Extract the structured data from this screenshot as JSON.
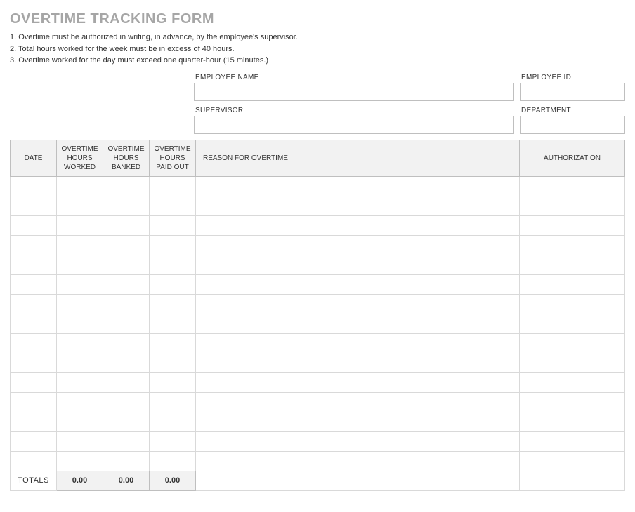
{
  "title": "OVERTIME TRACKING FORM",
  "rules": {
    "r1": "1. Overtime must be authorized in writing, in advance, by the employee's supervisor.",
    "r2": "2. Total hours worked for the week must be in excess of 40 hours.",
    "r3": "3. Overtime worked for the day must exceed one quarter-hour (15 minutes.)"
  },
  "info": {
    "employee_name_label": "EMPLOYEE NAME",
    "employee_name": "",
    "employee_id_label": "EMPLOYEE ID",
    "employee_id": "",
    "supervisor_label": "SUPERVISOR",
    "supervisor": "",
    "department_label": "DEPARTMENT",
    "department": ""
  },
  "columns": {
    "date": "DATE",
    "worked": "OVERTIME HOURS WORKED",
    "banked": "OVERTIME HOURS BANKED",
    "paid": "OVERTIME HOURS PAID OUT",
    "reason": "REASON FOR OVERTIME",
    "auth": "AUTHORIZATION"
  },
  "rows": [
    {
      "date": "",
      "worked": "",
      "banked": "",
      "paid": "",
      "reason": "",
      "auth": ""
    },
    {
      "date": "",
      "worked": "",
      "banked": "",
      "paid": "",
      "reason": "",
      "auth": ""
    },
    {
      "date": "",
      "worked": "",
      "banked": "",
      "paid": "",
      "reason": "",
      "auth": ""
    },
    {
      "date": "",
      "worked": "",
      "banked": "",
      "paid": "",
      "reason": "",
      "auth": ""
    },
    {
      "date": "",
      "worked": "",
      "banked": "",
      "paid": "",
      "reason": "",
      "auth": ""
    },
    {
      "date": "",
      "worked": "",
      "banked": "",
      "paid": "",
      "reason": "",
      "auth": ""
    },
    {
      "date": "",
      "worked": "",
      "banked": "",
      "paid": "",
      "reason": "",
      "auth": ""
    },
    {
      "date": "",
      "worked": "",
      "banked": "",
      "paid": "",
      "reason": "",
      "auth": ""
    },
    {
      "date": "",
      "worked": "",
      "banked": "",
      "paid": "",
      "reason": "",
      "auth": ""
    },
    {
      "date": "",
      "worked": "",
      "banked": "",
      "paid": "",
      "reason": "",
      "auth": ""
    },
    {
      "date": "",
      "worked": "",
      "banked": "",
      "paid": "",
      "reason": "",
      "auth": ""
    },
    {
      "date": "",
      "worked": "",
      "banked": "",
      "paid": "",
      "reason": "",
      "auth": ""
    },
    {
      "date": "",
      "worked": "",
      "banked": "",
      "paid": "",
      "reason": "",
      "auth": ""
    },
    {
      "date": "",
      "worked": "",
      "banked": "",
      "paid": "",
      "reason": "",
      "auth": ""
    },
    {
      "date": "",
      "worked": "",
      "banked": "",
      "paid": "",
      "reason": "",
      "auth": ""
    }
  ],
  "totals": {
    "label": "TOTALS",
    "worked": "0.00",
    "banked": "0.00",
    "paid": "0.00"
  }
}
